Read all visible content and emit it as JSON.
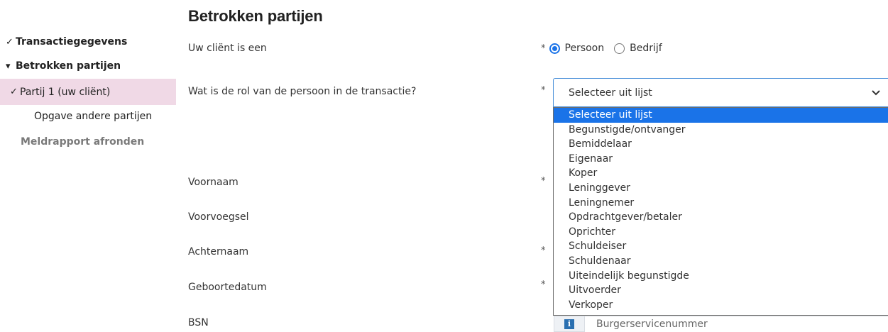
{
  "sidebar": {
    "items": [
      {
        "label": "Transactiegegevens",
        "mark": "✓"
      },
      {
        "label": "Betrokken partijen",
        "mark": "▾"
      },
      {
        "label": "Partij 1 (uw cliënt)",
        "mark": "✓"
      },
      {
        "label": "Opgave andere partijen"
      },
      {
        "label": "Meldrapport afronden"
      }
    ]
  },
  "main": {
    "title": "Betrokken partijen",
    "required_marker": "*",
    "client_type": {
      "label": "Uw cliënt is een",
      "options": [
        "Persoon",
        "Bedrijf"
      ],
      "selected": "Persoon"
    },
    "role": {
      "label": "Wat is de rol van de persoon in de transactie?",
      "value": "Selecteer uit lijst",
      "options": [
        "Selecteer uit lijst",
        "Begunstigde/ontvanger",
        "Bemiddelaar",
        "Eigenaar",
        "Koper",
        "Leninggever",
        "Leningnemer",
        "Opdrachtgever/betaler",
        "Oprichter",
        "Schuldeiser",
        "Schuldenaar",
        "Uiteindelijk begunstigde",
        "Uitvoerder",
        "Verkoper"
      ]
    },
    "fields": {
      "voornaam": "Voornaam",
      "voorvoegsel": "Voorvoegsel",
      "achternaam": "Achternaam",
      "geboortedatum": "Geboortedatum",
      "bsn": "BSN"
    },
    "bsn_info_icon": "i",
    "bsn_placeholder": "Burgerservicenummer"
  },
  "colors": {
    "accent": "#1a73e8",
    "active_nav_bg": "#f0d9e6",
    "muted_nav": "#7a7a7a"
  }
}
